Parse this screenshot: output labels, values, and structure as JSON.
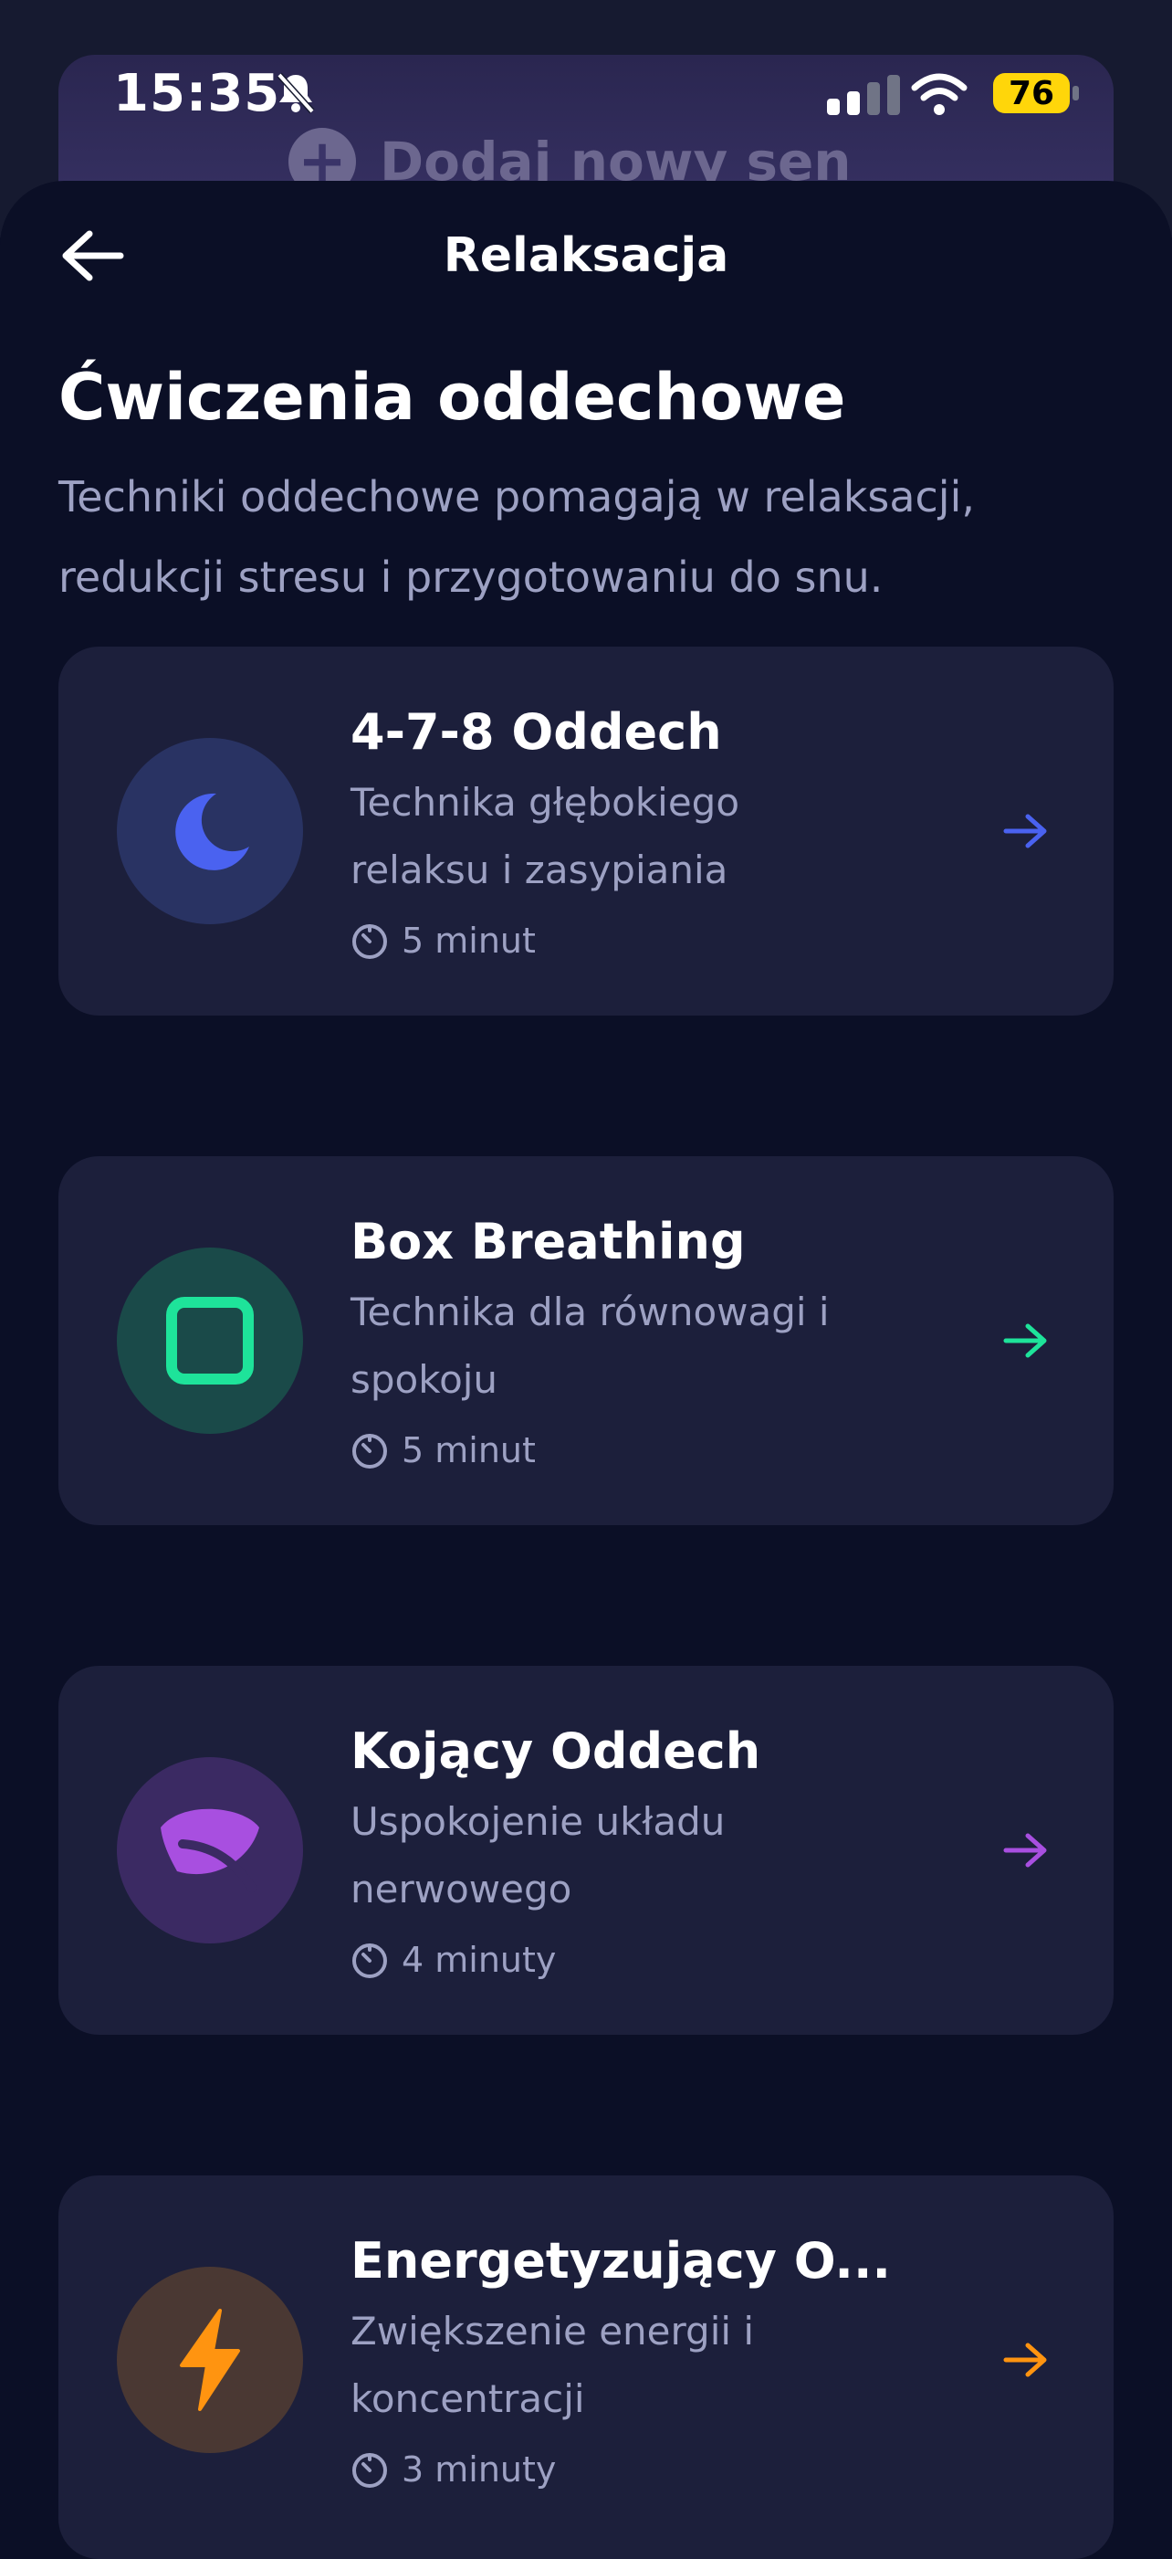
{
  "status_bar": {
    "time": "15:35",
    "battery": "76"
  },
  "background": {
    "add_label": "Dodaj nowy sen"
  },
  "header": {
    "title": "Relaksacja"
  },
  "page": {
    "heading": "Ćwiczenia oddechowe",
    "description": "Techniki oddechowe pomagają w relaksacji, redukcji stresu i przygotowaniu do snu."
  },
  "exercises": [
    {
      "title": "4-7-8 Oddech",
      "subtitle": "Technika głębokiego relaksu i zasypiania",
      "duration": "5 minut",
      "icon": "moon-icon",
      "accent": "#4a62f0",
      "icon_bg": "#293363"
    },
    {
      "title": "Box Breathing",
      "subtitle": "Technika dla równowagi i spokoju",
      "duration": "5 minut",
      "icon": "square-icon",
      "accent": "#1ee39a",
      "icon_bg": "#1a4a49"
    },
    {
      "title": "Kojący Oddech",
      "subtitle": "Uspokojenie układu nerwowego",
      "duration": "4 minuty",
      "icon": "leaf-icon",
      "accent": "#a84fe0",
      "icon_bg": "#3b2a63"
    },
    {
      "title": "Energetyzujący O...",
      "subtitle": "Zwiększenie energii i koncentracji",
      "duration": "3 minuty",
      "icon": "bolt-icon",
      "accent": "#ff9410",
      "icon_bg": "#4a3833"
    }
  ]
}
